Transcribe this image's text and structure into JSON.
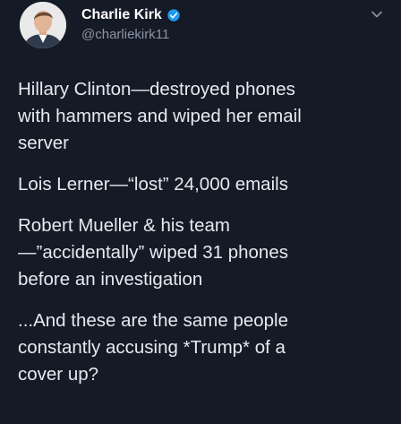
{
  "author": {
    "name": "Charlie Kirk",
    "handle": "@charliekirk11",
    "verified": true,
    "avatar_icon": "profile-photo"
  },
  "ui": {
    "menu_icon": "chevron-down-icon",
    "background": "#151a27",
    "verified_color": "#1d9bf0"
  },
  "tweet": {
    "paragraphs": [
      [
        "Hillary Clinton—destroyed phones",
        "with hammers and wiped her email",
        "server"
      ],
      [
        "Lois Lerner—“lost” 24,000 emails"
      ],
      [
        "Robert Mueller & his team",
        "—”accidentally” wiped 31 phones",
        "before an investigation"
      ],
      [
        "...And these are the same people",
        "constantly accusing *Trump* of a",
        "cover up?"
      ]
    ]
  }
}
